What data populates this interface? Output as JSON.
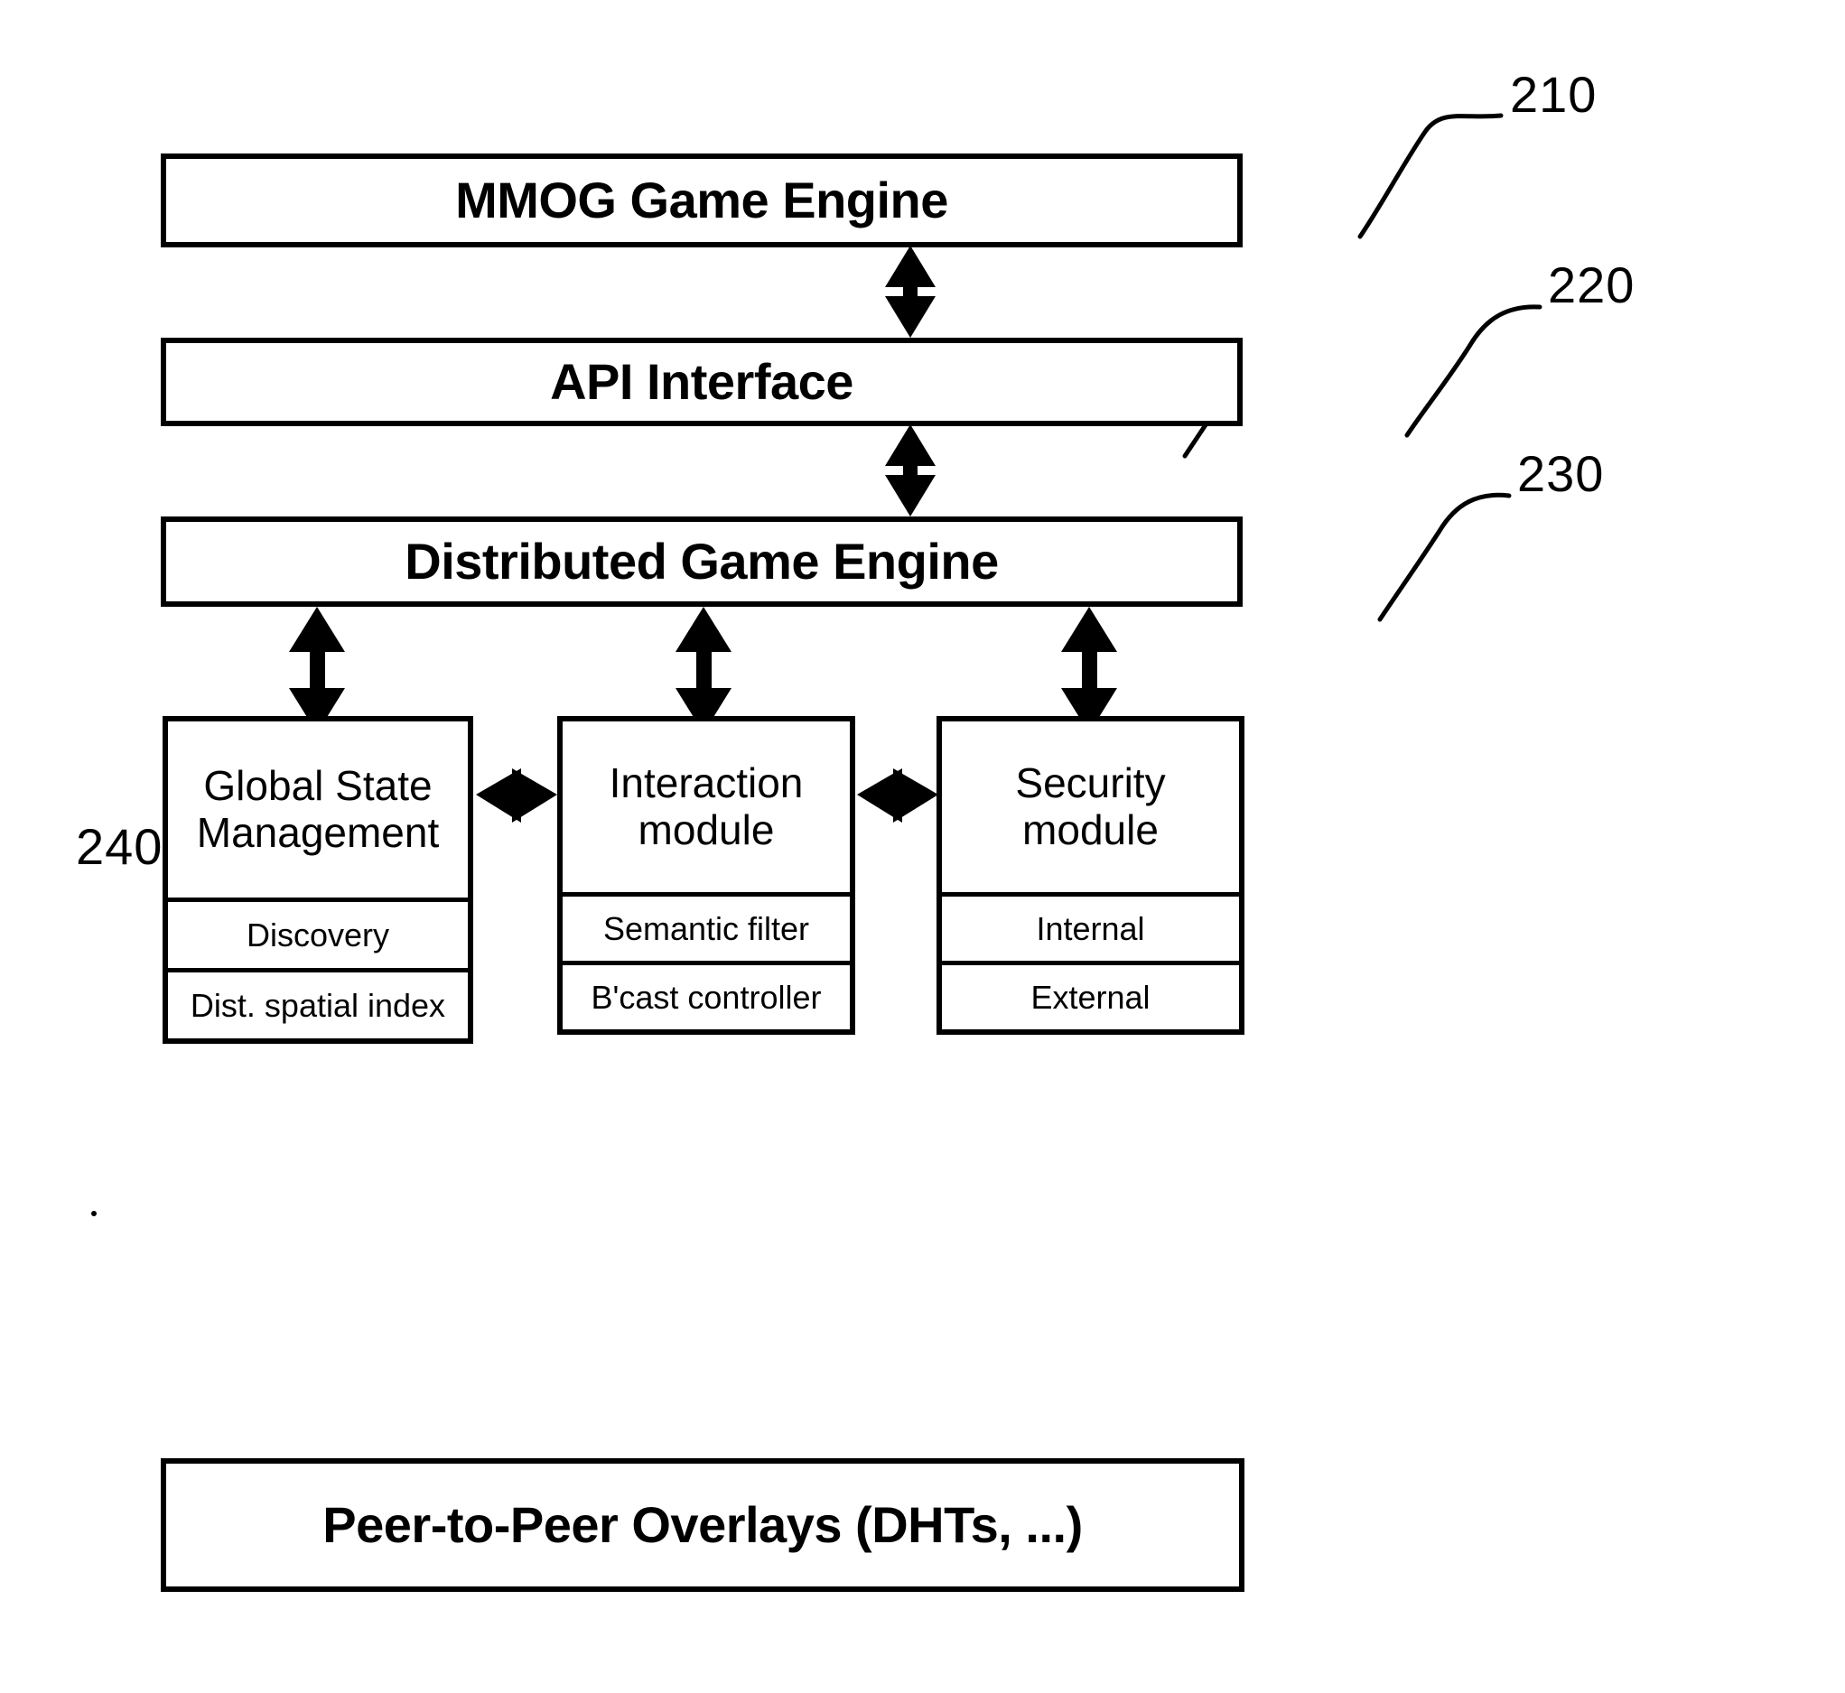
{
  "figure": {
    "type": "block-diagram",
    "ink_color": "#000000",
    "background": "#ffffff"
  },
  "layers": [
    {
      "id": "mmog",
      "title": "MMOG Game Engine",
      "ref": "210"
    },
    {
      "id": "api",
      "title": "API Interface",
      "ref": "220"
    },
    {
      "id": "dge",
      "title": "Distributed Game Engine",
      "ref": "230"
    },
    {
      "id": "p2p",
      "title": "Peer-to-Peer Overlays (DHTs, ...)",
      "ref": ""
    }
  ],
  "modules": {
    "ref": "240",
    "items": [
      {
        "id": "global-state",
        "title_line1": "Global State",
        "title_line2": "Management",
        "sub": [
          "Discovery",
          "Dist. spatial index"
        ]
      },
      {
        "id": "interaction",
        "title_line1": "Interaction",
        "title_line2": "module",
        "sub": [
          "Semantic filter",
          "B'cast controller"
        ]
      },
      {
        "id": "security",
        "title_line1": "Security",
        "title_line2": "module",
        "sub": [
          "Internal",
          "External"
        ]
      }
    ]
  },
  "refs": {
    "r210": "210",
    "r220": "220",
    "r230": "230",
    "r240": "240"
  },
  "connectors": [
    {
      "id": "mmog-api",
      "kind": "double-arrow-vertical"
    },
    {
      "id": "api-dge",
      "kind": "double-arrow-vertical"
    },
    {
      "id": "dge-global-state",
      "kind": "double-arrow-vertical"
    },
    {
      "id": "dge-interaction",
      "kind": "double-arrow-vertical"
    },
    {
      "id": "dge-security",
      "kind": "double-arrow-vertical"
    },
    {
      "id": "global-interaction",
      "kind": "double-arrow-horizontal"
    },
    {
      "id": "interaction-security",
      "kind": "double-arrow-horizontal"
    }
  ]
}
